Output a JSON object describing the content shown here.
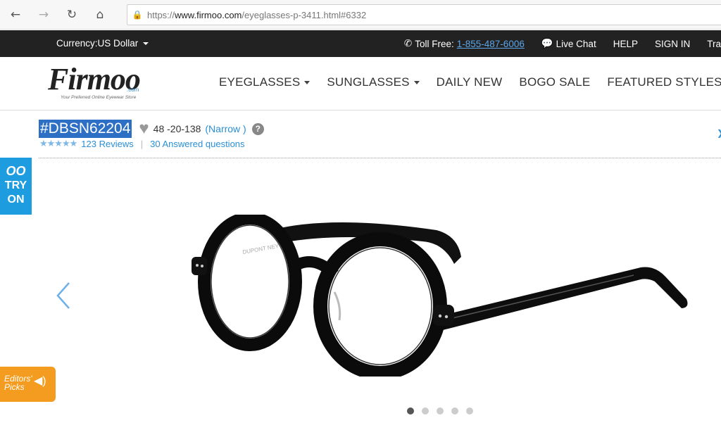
{
  "browser": {
    "url_prefix": "https://",
    "url_domain": "www.firmoo.com",
    "url_path": "/eyeglasses-p-3411.html#6332"
  },
  "topbar": {
    "currency": "Currency:US Dollar",
    "toll_free_label": "Toll Free:",
    "toll_free_number": "1-855-487-6006",
    "live_chat": "Live Chat",
    "help": "HELP",
    "sign_in": "SIGN IN",
    "truncated": "Tra"
  },
  "logo": {
    "word": "Firmoo",
    "com": ".com",
    "tagline": "Your Preferred Online Eyewear Store"
  },
  "nav": {
    "eyeglasses": "EYEGLASSES",
    "sunglasses": "SUNGLASSES",
    "daily_new": "DAILY NEW",
    "bogo_sale": "BOGO SALE",
    "featured_styles": "FEATURED STYLES"
  },
  "product": {
    "sku": "#DBSN62204",
    "size": "48 -20-138",
    "fit": "(Narrow )",
    "help_mark": "?",
    "rating_stars": 5,
    "reviews": "123 Reviews",
    "questions": "30 Answered questions",
    "frame_brand": "DUPONT NEY"
  },
  "tryon": {
    "icon_text": "OO",
    "line1": "TRY",
    "line2": "ON"
  },
  "carousel": {
    "slide_count": 5,
    "active_index": 0
  },
  "editors_picks": {
    "line1": "Editors'",
    "line2": "Picks"
  },
  "colors": {
    "topbar_bg": "#222222",
    "link_blue": "#2a8fd6",
    "tryon_blue": "#1e9ce0",
    "editors_orange": "#f39c1f",
    "selection_blue": "#2d6fc4"
  }
}
